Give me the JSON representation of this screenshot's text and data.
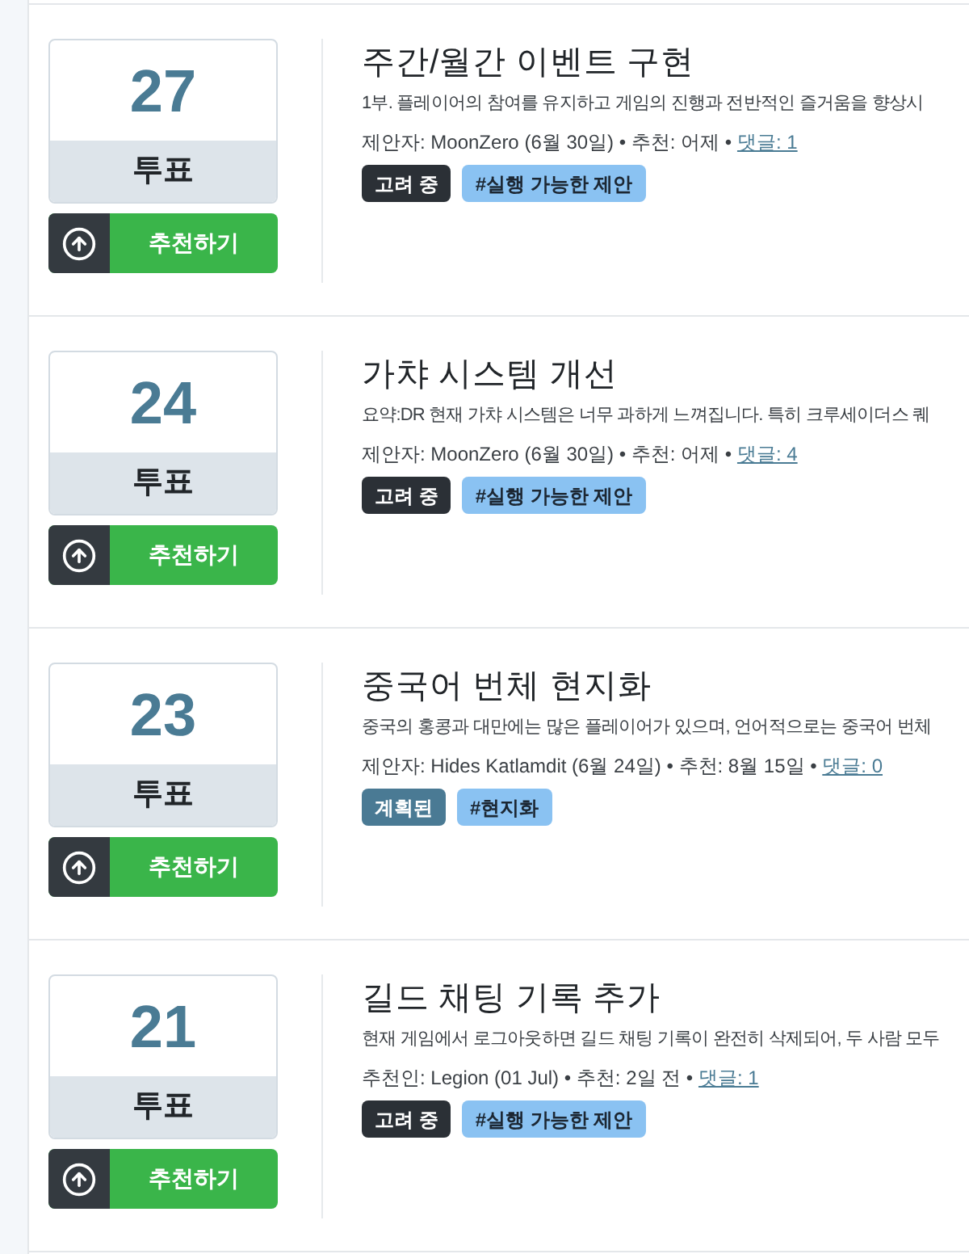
{
  "proposals": [
    {
      "votes": "27",
      "votes_label": "투표",
      "recommend_button": "추천하기",
      "title": "주간/월간 이벤트 구현",
      "summary": "1부. 플레이어의 참여를 유지하고 게임의 진행과 전반적인 즐거움을 향상시",
      "meta": "제안자: MoonZero (6월 30일) • 추천: 어제 •",
      "comments": "댓글: 1",
      "status": {
        "label": "고려 중",
        "color": "#2b3036"
      },
      "tags": [
        "#실행 가능한 제안"
      ]
    },
    {
      "votes": "24",
      "votes_label": "투표",
      "recommend_button": "추천하기",
      "title": "가챠 시스템 개선",
      "summary": "요약:DR 현재 가챠 시스템은 너무 과하게 느껴집니다. 특히 크루세이더스 퀘",
      "meta": "제안자: MoonZero (6월 30일) • 추천: 어제 •",
      "comments": "댓글: 4",
      "status": {
        "label": "고려 중",
        "color": "#2b3036"
      },
      "tags": [
        "#실행 가능한 제안"
      ]
    },
    {
      "votes": "23",
      "votes_label": "투표",
      "recommend_button": "추천하기",
      "title": "중국어 번체 현지화",
      "summary": "중국의 홍콩과 대만에는 많은 플레이어가 있으며, 언어적으로는 중국어 번체",
      "meta": "제안자: Hides Katlamdit (6월 24일) • 추천: 8월 15일 •",
      "comments": "댓글: 0",
      "status": {
        "label": "계획된",
        "color": "#4a7a94"
      },
      "tags": [
        "#현지화"
      ]
    },
    {
      "votes": "21",
      "votes_label": "투표",
      "recommend_button": "추천하기",
      "title": "길드 채팅 기록 추가",
      "summary": "현재 게임에서 로그아웃하면 길드 채팅 기록이 완전히 삭제되어, 두 사람 모두",
      "meta": "추천인: Legion (01 Jul) • 추천: 2일 전 •",
      "comments": "댓글: 1",
      "status": {
        "label": "고려 중",
        "color": "#2b3036"
      },
      "tags": [
        "#실행 가능한 제안"
      ]
    }
  ]
}
